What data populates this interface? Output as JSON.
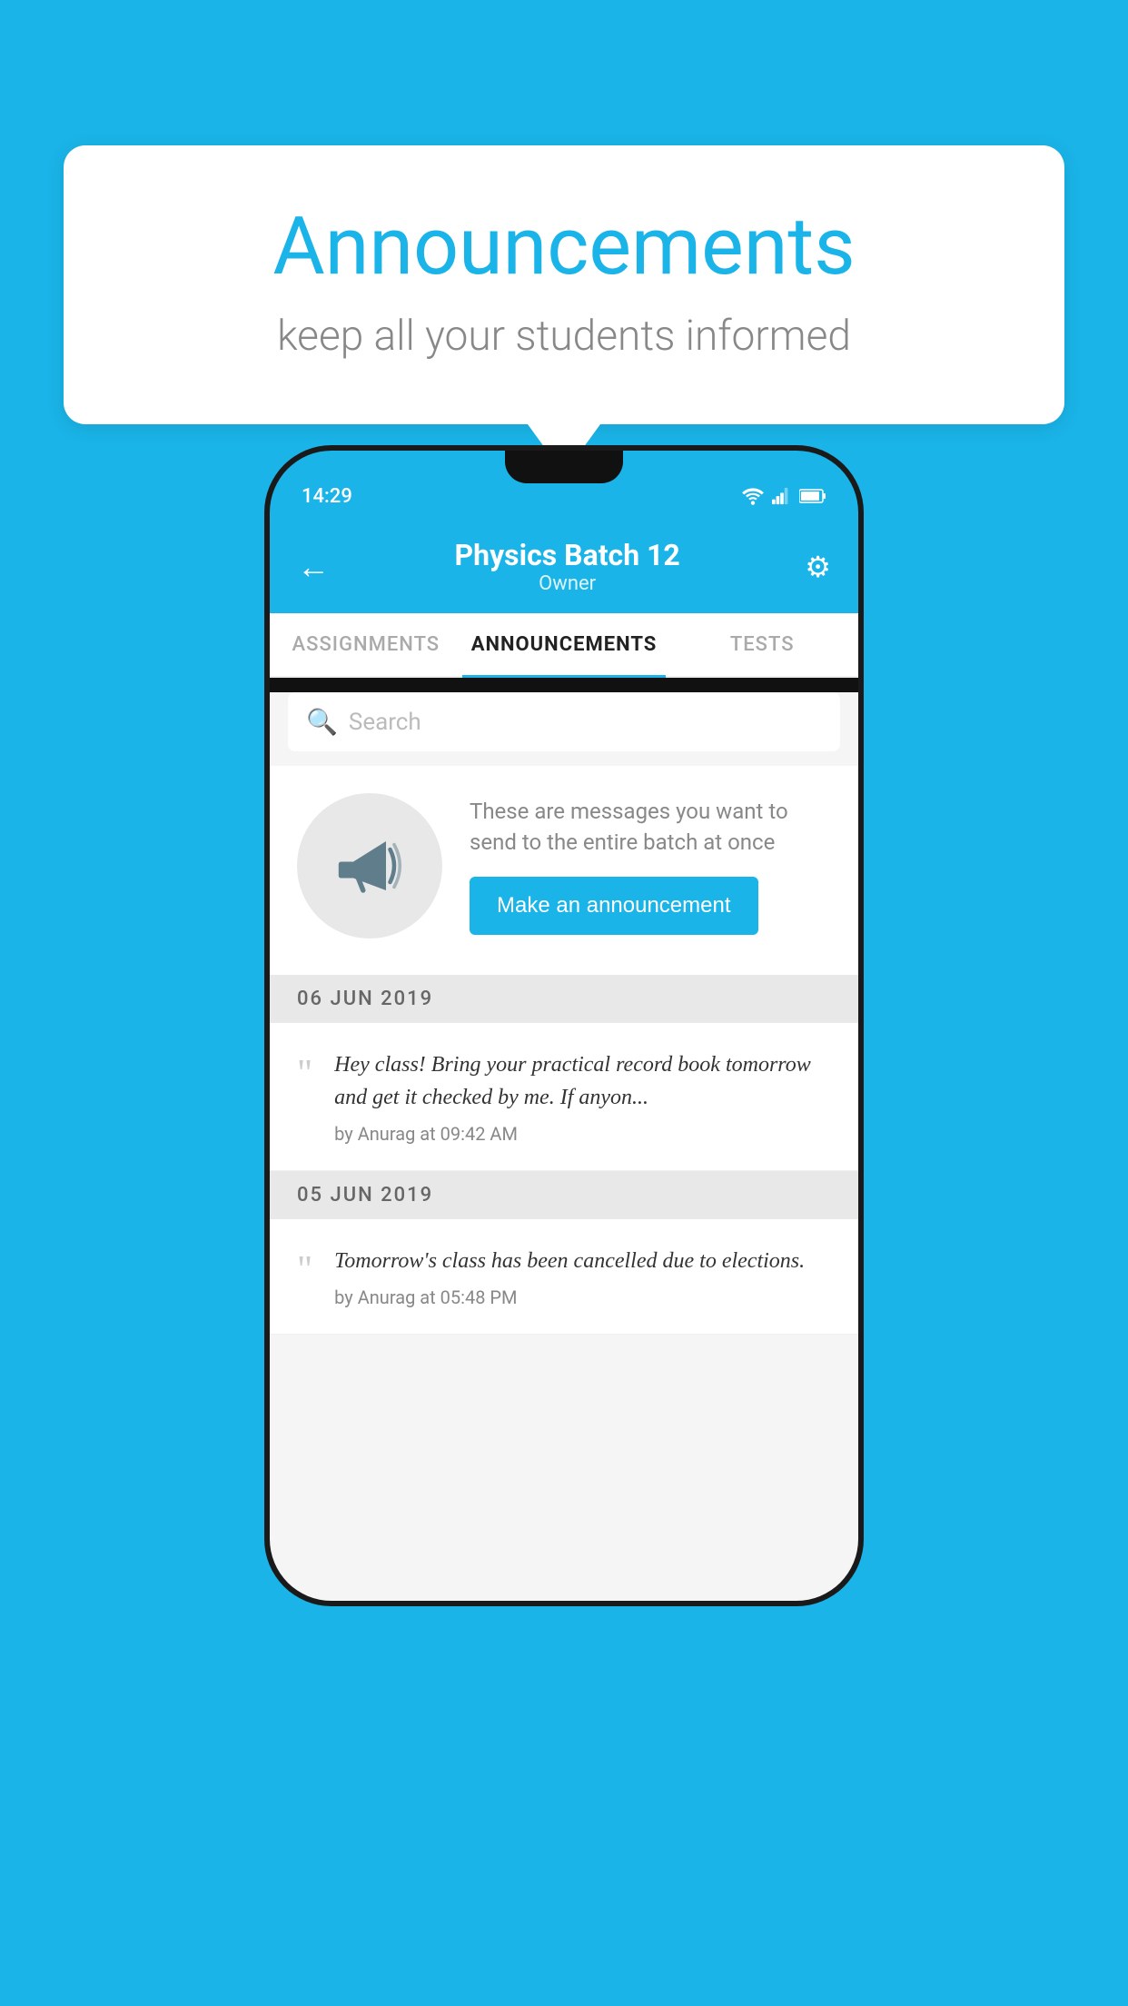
{
  "background_color": "#1ab4e8",
  "speech_bubble": {
    "title": "Announcements",
    "subtitle": "keep all your students informed"
  },
  "phone": {
    "status_bar": {
      "time": "14:29"
    },
    "app_bar": {
      "title": "Physics Batch 12",
      "subtitle": "Owner",
      "back_icon": "←",
      "gear_icon": "⚙"
    },
    "tabs": [
      {
        "label": "ASSIGNMENTS",
        "active": false
      },
      {
        "label": "ANNOUNCEMENTS",
        "active": true
      },
      {
        "label": "TESTS",
        "active": false
      },
      {
        "label": "...",
        "active": false
      }
    ],
    "search": {
      "placeholder": "Search"
    },
    "empty_state": {
      "description": "These are messages you want to send to the entire batch at once",
      "button_label": "Make an announcement"
    },
    "announcements": [
      {
        "date": "06  JUN  2019",
        "text": "Hey class! Bring your practical record book tomorrow and get it checked by me. If anyon...",
        "meta": "by Anurag at 09:42 AM"
      },
      {
        "date": "05  JUN  2019",
        "text": "Tomorrow's class has been cancelled due to elections.",
        "meta": "by Anurag at 05:48 PM"
      }
    ]
  }
}
